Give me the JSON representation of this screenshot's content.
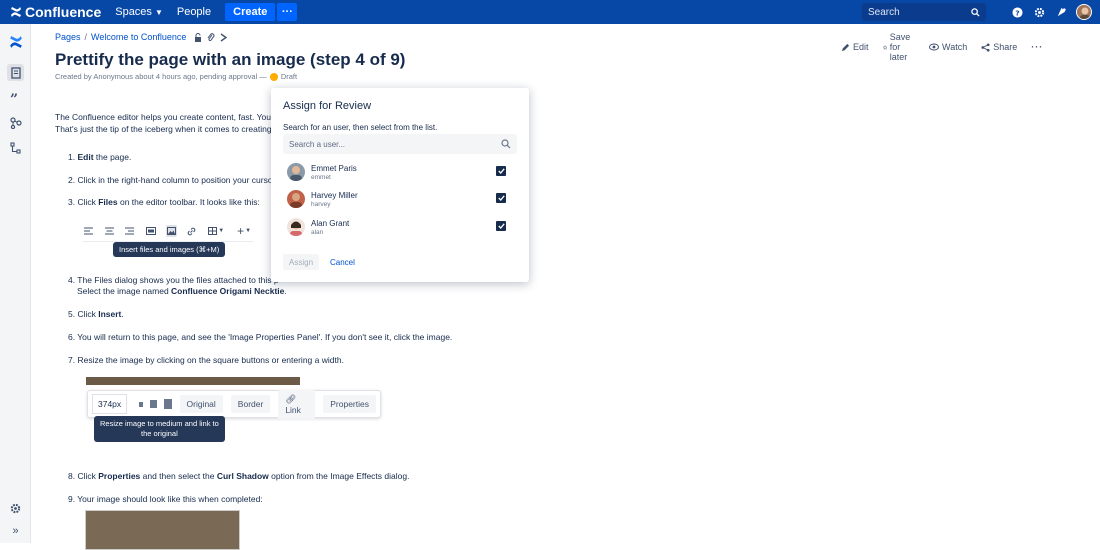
{
  "topbar": {
    "app_name": "Confluence",
    "nav": [
      "Spaces",
      "People"
    ],
    "create_label": "Create",
    "more_label": "···",
    "search_placeholder": "Search"
  },
  "breadcrumb": [
    "Pages",
    "Welcome to Confluence"
  ],
  "page_actions": [
    "Edit",
    "Save for later",
    "Watch",
    "Share"
  ],
  "page": {
    "title": "Prettify the page with an image (step 4 of 9)",
    "byline": "Created by Anonymous about 4 hours ago, pending approval —",
    "status": "Draft",
    "intro_1": "The Confluence editor helps you create content, fast. You c",
    "intro_2": "That's just the tip of the iceberg when it comes to creating"
  },
  "steps": {
    "s1_num": "1.",
    "s1_bold": "Edit",
    "s1_rest": " the page.",
    "s2": "2. Click in the right-hand column to position your curso",
    "s3_pre": "3. Click ",
    "s3_bold": "Files",
    "s3_rest": " on the editor toolbar. It looks like this:",
    "s4_line1": "4. The Files dialog shows you the files attached to this p",
    "s4_line2_pre": "Select the image named ",
    "s4_line2_bold": "Confluence Origami Necktie",
    "s5_pre": "5. Click ",
    "s5_bold": "Insert",
    "s6": "6. You will return to this page, and see the 'Image Properties Panel'. If you don't see it, click the image.",
    "s7": "7. Resize the image by clicking on the square buttons or entering a width.",
    "s8_pre": "8. Click ",
    "s8_bold1": "Properties",
    "s8_mid": " and then select the ",
    "s8_bold2": "Curl Shadow",
    "s8_rest": " option from the Image Effects dialog.",
    "s9": "9. Your image should look like this when completed:"
  },
  "editor_tooltip": "Insert files and images (⌘+M)",
  "image_toolbar": {
    "width_value": "374px",
    "buttons": [
      "Original",
      "Border",
      "Link",
      "Properties"
    ],
    "tooltip_line1": "Resize image to medium and link to",
    "tooltip_line2": "the original"
  },
  "modal": {
    "title": "Assign for Review",
    "subtitle": "Search for an user, then select from the list.",
    "search_placeholder": "Search a user...",
    "users": [
      {
        "name": "Emmet Paris",
        "handle": "emmet",
        "checked": true
      },
      {
        "name": "Harvey Miller",
        "handle": "harvey",
        "checked": true
      },
      {
        "name": "Alan Grant",
        "handle": "alan",
        "checked": true
      }
    ],
    "assign_label": "Assign",
    "cancel_label": "Cancel"
  },
  "colors": {
    "topbar": "#0747a6",
    "create": "#0065ff",
    "link": "#0052cc",
    "draft": "#ffab00"
  }
}
